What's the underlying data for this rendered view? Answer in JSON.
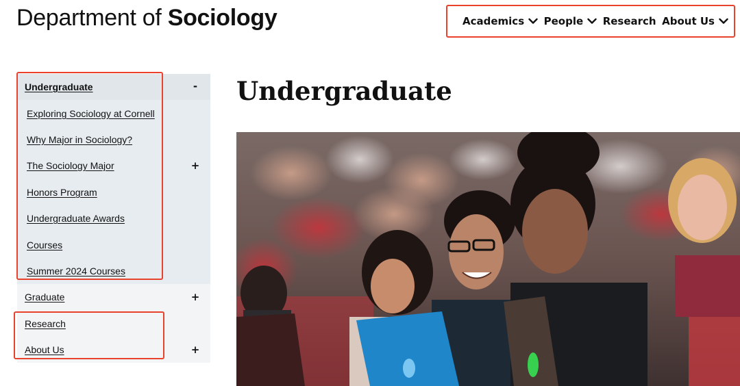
{
  "header": {
    "title_regular": "Department of ",
    "title_bold": "Sociology"
  },
  "nav": {
    "items": [
      {
        "label": "Academics",
        "has_dropdown": true
      },
      {
        "label": "People",
        "has_dropdown": true
      },
      {
        "label": "Research",
        "has_dropdown": false
      },
      {
        "label": "About Us",
        "has_dropdown": true
      }
    ]
  },
  "sidebar": {
    "undergraduate": {
      "label": "Undergraduate",
      "toggle": "-",
      "items": [
        {
          "label": "Exploring Sociology at Cornell",
          "toggle": ""
        },
        {
          "label": "Why Major in Sociology?",
          "toggle": ""
        },
        {
          "label": "The Sociology Major",
          "toggle": "+"
        },
        {
          "label": "Honors Program",
          "toggle": ""
        },
        {
          "label": "Undergraduate Awards",
          "toggle": ""
        },
        {
          "label": "Courses",
          "toggle": ""
        },
        {
          "label": "Summer 2024 Courses",
          "toggle": ""
        }
      ]
    },
    "graduate": {
      "label": "Graduate",
      "toggle": "+"
    },
    "research": {
      "label": "Research",
      "toggle": ""
    },
    "about": {
      "label": "About Us",
      "toggle": "+"
    }
  },
  "main": {
    "heading": "Undergraduate"
  },
  "colors": {
    "highlight": "#e8412c",
    "sidebar_active_bg": "#e7ecf0",
    "sidebar_bg": "#f2f4f6"
  }
}
